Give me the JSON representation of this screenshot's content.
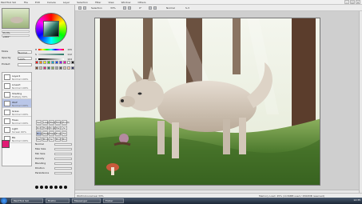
{
  "app": {
    "logo": "PaintTool SAI",
    "menus": [
      "File",
      "Edit",
      "Canvas",
      "Layer",
      "Selection",
      "Filter",
      "View",
      "Window",
      "Others"
    ],
    "window_buttons": [
      "–",
      "□",
      "×"
    ]
  },
  "toolbar": {
    "selection_label": "Selection",
    "zoom": "33%",
    "rotation": "0°",
    "mode": "Normal",
    "stabilizer": "S-3"
  },
  "navigator": {
    "zoom": "33.3%",
    "angle": "+000°"
  },
  "color_panel": {
    "slider_labels": [
      "H",
      "S",
      "V"
    ],
    "slider_values": [
      "155",
      "112",
      "104"
    ],
    "swatches": [
      "#ff0000",
      "#ff8800",
      "#ffee00",
      "#44cc00",
      "#00aacc",
      "#0044ff",
      "#8800ff",
      "#ff00aa",
      "#ffffff",
      "#000000",
      "#7a4a2a",
      "#c9bdb0",
      "#e11b74",
      "#2e7a6a",
      "#88aa55",
      "#a0a0a0",
      "#555555",
      "#d8c8a8",
      "#ffccaa",
      "#333366"
    ]
  },
  "layer_panel": {
    "fields": [
      {
        "label": "Mode",
        "value": "Normal"
      },
      {
        "label": "Opacity",
        "value": "100%"
      },
      {
        "label": "Protect",
        "value": ""
      }
    ],
    "layers": [
      {
        "name": "Layer4",
        "mode": "Normal 100%"
      },
      {
        "name": "Lineart",
        "mode": "Normal 100%"
      },
      {
        "name": "Shading",
        "mode": "Multiply 80%"
      },
      {
        "name": "Wolf",
        "mode": "Normal 100%"
      },
      {
        "name": "Grass",
        "mode": "Normal 100%"
      },
      {
        "name": "Trees",
        "mode": "Normal 100%"
      },
      {
        "name": "Light",
        "mode": "Screen 60%"
      },
      {
        "name": "BG",
        "mode": "Normal 100%"
      }
    ]
  },
  "tools": [
    "Sel",
    "Lasso",
    "Wand",
    "Move",
    "Zoom",
    "Rot",
    "Hand",
    "Drop",
    "Pen",
    "Air",
    "Brush",
    "Water",
    "Mark",
    "Eras",
    "Fill",
    "Pen",
    "Brush",
    "Air",
    "Blur",
    "Bin"
  ],
  "tool_options": [
    {
      "label": "Normal"
    },
    {
      "label": "Max Size"
    },
    {
      "label": "Min Size"
    },
    {
      "label": "Density"
    },
    {
      "label": "Blending"
    },
    {
      "label": "Dilution"
    },
    {
      "label": "Persistence"
    }
  ],
  "status": {
    "file": "Wolf-Coloured.sai 33%",
    "memory": "Memory Load: 45% (1136MB used / 2560MB reserved)"
  },
  "taskbar": {
    "items": [
      "PaintTool SAI",
      "Firefox",
      "Messenger",
      "Folder"
    ],
    "clock": "12:35"
  }
}
